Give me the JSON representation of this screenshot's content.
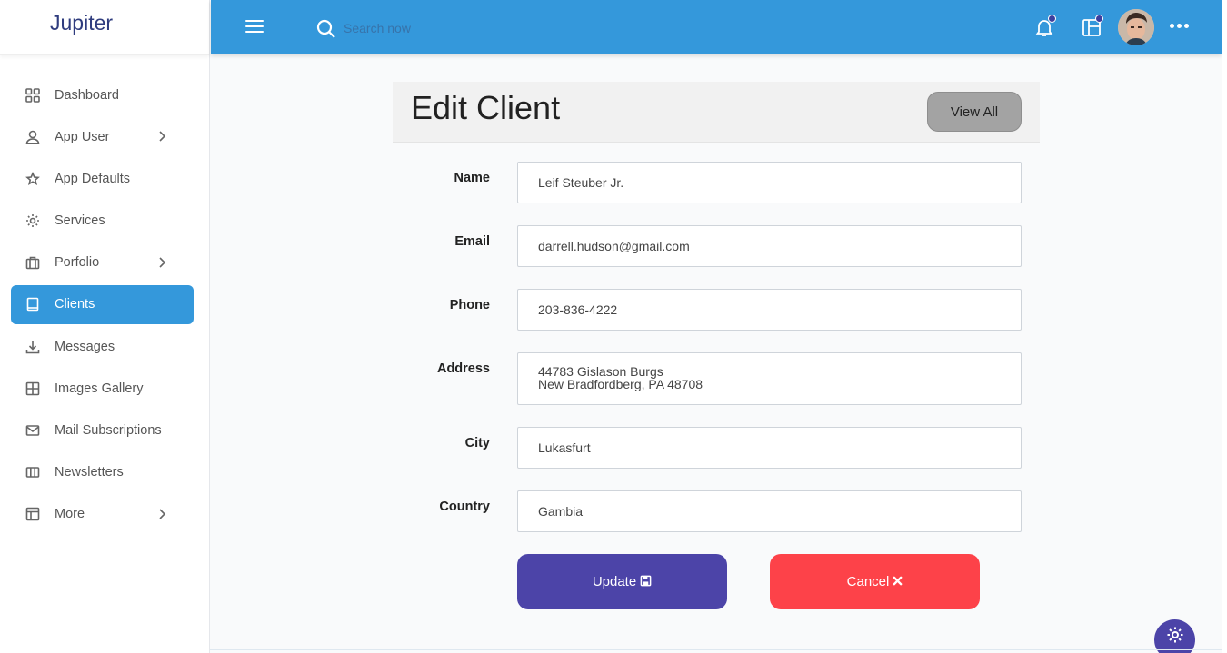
{
  "brand": {
    "name": "Jupiter"
  },
  "sidebar": {
    "items": [
      {
        "label": "Dashboard",
        "icon": "dashboard-icon",
        "has_chevron": false,
        "active": false
      },
      {
        "label": "App User",
        "icon": "user-icon",
        "has_chevron": true,
        "active": false
      },
      {
        "label": "App Defaults",
        "icon": "star-icon",
        "has_chevron": false,
        "active": false
      },
      {
        "label": "Services",
        "icon": "gear-icon",
        "has_chevron": false,
        "active": false
      },
      {
        "label": "Porfolio",
        "icon": "briefcase-icon",
        "has_chevron": true,
        "active": false
      },
      {
        "label": "Clients",
        "icon": "book-icon",
        "has_chevron": false,
        "active": true
      },
      {
        "label": "Messages",
        "icon": "download-icon",
        "has_chevron": false,
        "active": false
      },
      {
        "label": "Images Gallery",
        "icon": "grid-icon",
        "has_chevron": false,
        "active": false
      },
      {
        "label": "Mail Subscriptions",
        "icon": "mail-icon",
        "has_chevron": false,
        "active": false
      },
      {
        "label": "Newsletters",
        "icon": "columns-icon",
        "has_chevron": false,
        "active": false
      },
      {
        "label": "More",
        "icon": "layout-icon",
        "has_chevron": true,
        "active": false
      }
    ]
  },
  "topbar": {
    "search_placeholder": "Search now",
    "icons": [
      "menu-icon",
      "search-icon",
      "bell-icon",
      "widgets-icon",
      "avatar",
      "more-icon"
    ]
  },
  "page": {
    "title": "Edit Client",
    "view_all_label": "View All"
  },
  "form": {
    "name_label": "Name",
    "name_value": "Leif Steuber Jr.",
    "email_label": "Email",
    "email_value": "darrell.hudson@gmail.com",
    "phone_label": "Phone",
    "phone_value": "203-836-4222",
    "address_label": "Address",
    "address_value": "44783 Gislason Burgs\nNew Bradfordberg, PA 48708",
    "city_label": "City",
    "city_value": "Lukasfurt",
    "country_label": "Country",
    "country_value": "Gambia",
    "update_label": "Update",
    "cancel_label": "Cancel"
  },
  "colors": {
    "topbar": "#3498db",
    "active_nav": "#3498db",
    "update_button": "#4c44a8",
    "cancel_button": "#fd4249",
    "view_all_button": "#a3a3a3"
  }
}
